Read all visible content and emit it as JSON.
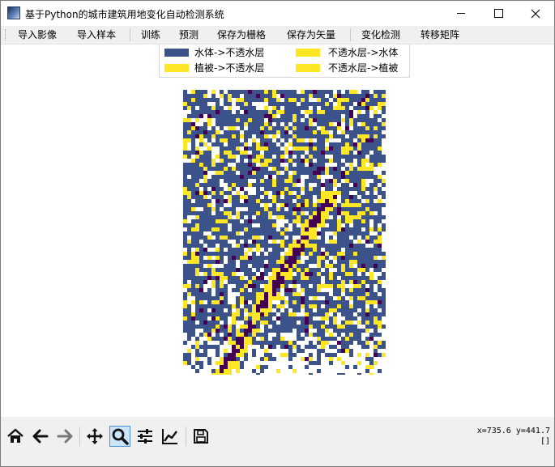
{
  "window": {
    "title": "基于Python的城市建筑用地变化自动检测系统"
  },
  "menu": {
    "items": [
      "导入影像",
      "导入样本",
      "训练",
      "预测",
      "保存为栅格",
      "保存为矢量",
      "变化检测",
      "转移矩阵"
    ]
  },
  "legend": {
    "entries": [
      {
        "label": "水体->不透水层",
        "color": "#3b528b"
      },
      {
        "label": "不透水层->水体",
        "color": "#fde725"
      },
      {
        "label": "植被->不透水层",
        "color": "#fde725"
      },
      {
        "label": "不透水层->植被",
        "color": "#fde725"
      }
    ]
  },
  "map": {
    "colors": {
      "background": "#ffffff",
      "outline": "#3b528b",
      "change": "#fde725",
      "dark": "#440154"
    }
  },
  "toolbar": {
    "buttons": [
      {
        "icon": "home-icon",
        "name": "home"
      },
      {
        "icon": "back-arrow-icon",
        "name": "back"
      },
      {
        "icon": "forward-arrow-icon",
        "name": "forward"
      },
      {
        "icon": "pan-icon",
        "name": "pan"
      },
      {
        "icon": "zoom-icon",
        "name": "zoom",
        "active": true
      },
      {
        "icon": "configure-subplots-icon",
        "name": "subplots"
      },
      {
        "icon": "edit-axis-icon",
        "name": "edit-axis"
      },
      {
        "icon": "save-icon",
        "name": "save"
      }
    ],
    "coords": "x=735.6 y=441.7",
    "coords_value": "[]"
  }
}
